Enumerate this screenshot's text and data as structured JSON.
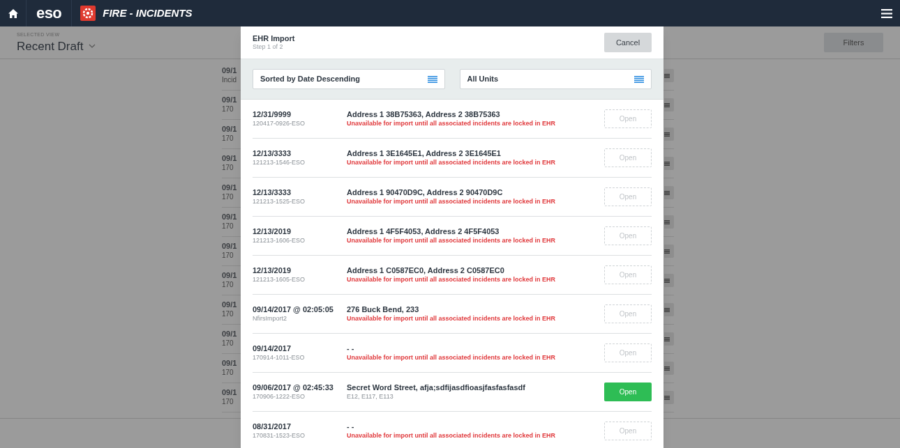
{
  "top_bar": {
    "app_logo": "eso",
    "module_title": "FIRE - INCIDENTS"
  },
  "subheader": {
    "label": "SELECTED VIEW",
    "view": "Recent Draft",
    "filters_button": "Filters"
  },
  "background_rows": [
    {
      "date": "09/1",
      "sub": "Incid"
    },
    {
      "date": "09/1",
      "sub": "170"
    },
    {
      "date": "09/1",
      "sub": "170"
    },
    {
      "date": "09/1",
      "sub": "170"
    },
    {
      "date": "09/1",
      "sub": "170"
    },
    {
      "date": "09/1",
      "sub": "170"
    },
    {
      "date": "09/1",
      "sub": "170"
    },
    {
      "date": "09/1",
      "sub": "170"
    },
    {
      "date": "09/1",
      "sub": "170"
    },
    {
      "date": "09/1",
      "sub": "170"
    },
    {
      "date": "09/1",
      "sub": "170"
    },
    {
      "date": "09/1",
      "sub": "170"
    }
  ],
  "modal": {
    "title": "EHR Import",
    "step": "Step 1 of 2",
    "cancel": "Cancel",
    "sort_select": "Sorted by Date Descending",
    "unit_select": "All Units",
    "rows": [
      {
        "date": "12/31/9999",
        "id": "120417-0926-ESO",
        "address": "Address 1 38B75363, Address 2 38B75363",
        "note": "Unavailable for import until all associated incidents are locked in EHR",
        "available": false,
        "button": "Open"
      },
      {
        "date": "12/13/3333",
        "id": "121213-1546-ESO",
        "address": "Address 1 3E1645E1, Address 2 3E1645E1",
        "note": "Unavailable for import until all associated incidents are locked in EHR",
        "available": false,
        "button": "Open"
      },
      {
        "date": "12/13/3333",
        "id": "121213-1525-ESO",
        "address": "Address 1 90470D9C, Address 2 90470D9C",
        "note": "Unavailable for import until all associated incidents are locked in EHR",
        "available": false,
        "button": "Open"
      },
      {
        "date": "12/13/2019",
        "id": "121213-1606-ESO",
        "address": "Address 1 4F5F4053, Address 2 4F5F4053",
        "note": "Unavailable for import until all associated incidents are locked in EHR",
        "available": false,
        "button": "Open"
      },
      {
        "date": "12/13/2019",
        "id": "121213-1605-ESO",
        "address": "Address 1 C0587EC0, Address 2 C0587EC0",
        "note": "Unavailable for import until all associated incidents are locked in EHR",
        "available": false,
        "button": "Open"
      },
      {
        "date": "09/14/2017 @ 02:05:05",
        "id": "NfirsImport2",
        "address": "276 Buck Bend, 233",
        "note": "Unavailable for import until all associated incidents are locked in EHR",
        "available": false,
        "button": "Open"
      },
      {
        "date": "09/14/2017",
        "id": "170914-1011-ESO",
        "address": "- -",
        "note": "Unavailable for import until all associated incidents are locked in EHR",
        "available": false,
        "button": "Open"
      },
      {
        "date": "09/06/2017 @ 02:45:33",
        "id": "170906-1222-ESO",
        "address": "Secret Word Street, afja;sdfijasdfioasjfasfasfasdf",
        "note": "E12, E117, E113",
        "available": true,
        "button": "Open"
      },
      {
        "date": "08/31/2017",
        "id": "170831-1523-ESO",
        "address": "- -",
        "note": "Unavailable for import until all associated incidents are locked in EHR",
        "available": false,
        "button": "Open"
      }
    ]
  }
}
